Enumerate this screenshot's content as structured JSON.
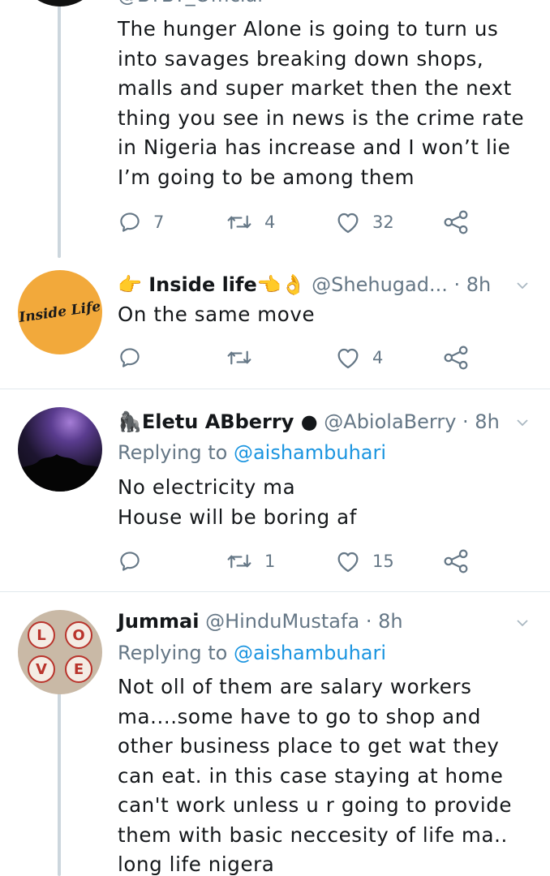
{
  "tweets": [
    {
      "name": "",
      "handle": "@BYBY_Official",
      "text": "The hunger Alone is going to turn us into savages breaking down shops, malls and super market then the next thing you see in news is the crime rate in Nigeria has increase and I won’t lie I’m going to be among them",
      "replies": "7",
      "retweets": "4",
      "likes": "32"
    },
    {
      "name": "👉 Inside life👈👌",
      "handle": "@Shehugad...",
      "time": "· 8h",
      "avatar_text": "Inside Life",
      "text": "On the same move",
      "replies": "",
      "retweets": "",
      "likes": "4"
    },
    {
      "name": "🦍Eletu ABberry ●",
      "handle": "@AbiolaBerry",
      "time": "· 8h",
      "replying_prefix": "Replying to",
      "replying_handle": "@aishambuhari",
      "text": "No electricity ma\nHouse will be boring af",
      "replies": "",
      "retweets": "1",
      "likes": "15"
    },
    {
      "name": "Jummai",
      "handle": "@HinduMustafa",
      "time": "· 8h",
      "replying_prefix": "Replying to",
      "replying_handle": "@aishambuhari",
      "avatar_letters": [
        "L",
        "O",
        "V",
        "E"
      ],
      "text": "Not oll of them are salary workers ma....some have to go to shop and other business place to get wat they can eat. in this case staying at home can't work unless u r going to provide them with basic neccesity of life ma..\nlong life nigera"
    }
  ],
  "colors": {
    "text": "#14171a",
    "secondary": "#657786",
    "link": "#1b95e0",
    "divider": "#e1e8ed",
    "thread": "#ccd6dd"
  },
  "icons": [
    "reply-icon",
    "retweet-icon",
    "like-icon",
    "share-icon",
    "chevron-down-icon"
  ]
}
